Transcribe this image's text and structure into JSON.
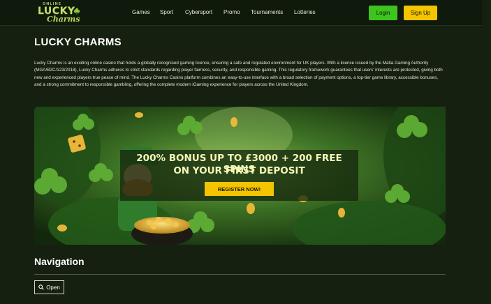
{
  "header": {
    "logo": {
      "tagline": "ONLINE",
      "word1": "LUCKY",
      "word2": "Charms",
      "icon": "clover-icon"
    },
    "nav": [
      "Games",
      "Sport",
      "Cybersport",
      "Promo",
      "Tournaments",
      "Lotteries"
    ],
    "login_label": "Login",
    "signup_label": "Sign Up"
  },
  "intro": {
    "title": "LUCKY CHARMS",
    "text": "Lucky Charms is an exciting online casino that holds a globally recognised gaming licence, ensuring a safe and regulated environment for UK players. With a licence issued by the Malta Gaming Authority (MGA/B2C/123/2018), Lucky Charms adheres to strict standards regarding player fairness, security, and responsible gaming. This regulatory framework guarantees that users' interests are protected, giving both new and experienced players true peace of mind. The Lucky Charms Casino platform combines an easy-to-use interface with a broad selection of payment options, a top-tier game library, accessible bonuses, and a strong commitment to responsible gambling, offering the complete modern iGaming experience for players across the United Kingdom."
  },
  "banner": {
    "headline1": "200% BONUS UP TO £3000 + 200 FREE SPINS",
    "headline2": "ON YOUR FIRST DEPOSIT",
    "cta": "REGISTER NOW!"
  },
  "navigation": {
    "title": "Navigation",
    "open_label": "Open",
    "open_icon": "search-icon"
  },
  "colors": {
    "background": "#162010",
    "header": "#0f1a0c",
    "login_green": "#3ec41e",
    "accent_yellow": "#f2c500",
    "promo_text": "#f3f7b8"
  }
}
